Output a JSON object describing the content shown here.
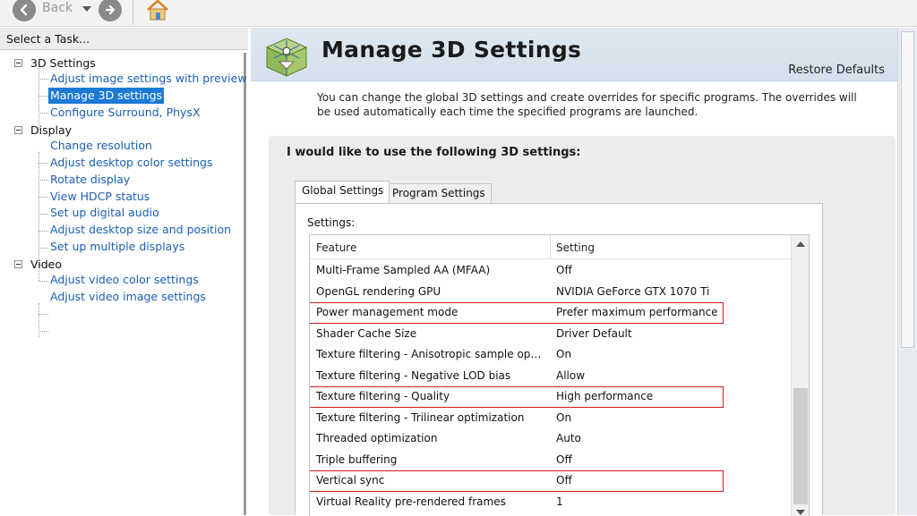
{
  "toolbar": {
    "back_label": "Back",
    "icons": [
      "back-arrow-icon",
      "forward-arrow-icon",
      "dropdown-arrow-icon",
      "home-icon"
    ]
  },
  "task_pane": {
    "header": "Select a Task...",
    "categories": [
      {
        "label": "3D Settings",
        "items": [
          "Adjust image settings with preview",
          "Manage 3D settings",
          "Configure Surround, PhysX"
        ]
      },
      {
        "label": "Display",
        "items": [
          "Change resolution",
          "Adjust desktop color settings",
          "Rotate display",
          "View HDCP status",
          "Set up digital audio",
          "Adjust desktop size and position",
          "Set up multiple displays"
        ]
      },
      {
        "label": "Video",
        "items": [
          "Adjust video color settings",
          "Adjust video image settings"
        ]
      }
    ],
    "selected_item": "Manage 3D settings"
  },
  "main": {
    "title": "Manage 3D Settings",
    "restore_defaults": "Restore Defaults",
    "description": "You can change the global 3D settings and create overrides for specific programs. The overrides will be used automatically each time the specified programs are launched.",
    "panel_heading": "I would like to use the following 3D settings:",
    "tabs": [
      {
        "label": "Global Settings",
        "active": true
      },
      {
        "label": "Program Settings",
        "active": false
      }
    ],
    "settings_label": "Settings:",
    "table": {
      "headers": [
        "Feature",
        "Setting"
      ],
      "rows": [
        {
          "feature": "Multi-Frame Sampled AA (MFAA)",
          "setting": "Off",
          "highlighted": false
        },
        {
          "feature": "OpenGL rendering GPU",
          "setting": "NVIDIA GeForce GTX 1070 Ti",
          "highlighted": false
        },
        {
          "feature": "Power management mode",
          "setting": "Prefer maximum performance",
          "highlighted": true
        },
        {
          "feature": "Shader Cache Size",
          "setting": "Driver Default",
          "highlighted": false
        },
        {
          "feature": "Texture filtering - Anisotropic sample opti...",
          "setting": "On",
          "highlighted": false
        },
        {
          "feature": "Texture filtering - Negative LOD bias",
          "setting": "Allow",
          "highlighted": false
        },
        {
          "feature": "Texture filtering - Quality",
          "setting": "High performance",
          "highlighted": true
        },
        {
          "feature": "Texture filtering - Trilinear optimization",
          "setting": "On",
          "highlighted": false
        },
        {
          "feature": "Threaded optimization",
          "setting": "Auto",
          "highlighted": false
        },
        {
          "feature": "Triple buffering",
          "setting": "Off",
          "highlighted": false
        },
        {
          "feature": "Vertical sync",
          "setting": "Off",
          "highlighted": true
        },
        {
          "feature": "Virtual Reality pre-rendered frames",
          "setting": "1",
          "highlighted": false
        }
      ]
    }
  },
  "colors": {
    "link": "#1a5fb4",
    "selection": "#1c79d6",
    "highlight_border": "#d71a1a",
    "header_gradient": "#d4e0ec",
    "panel_bg": "#ececec"
  }
}
